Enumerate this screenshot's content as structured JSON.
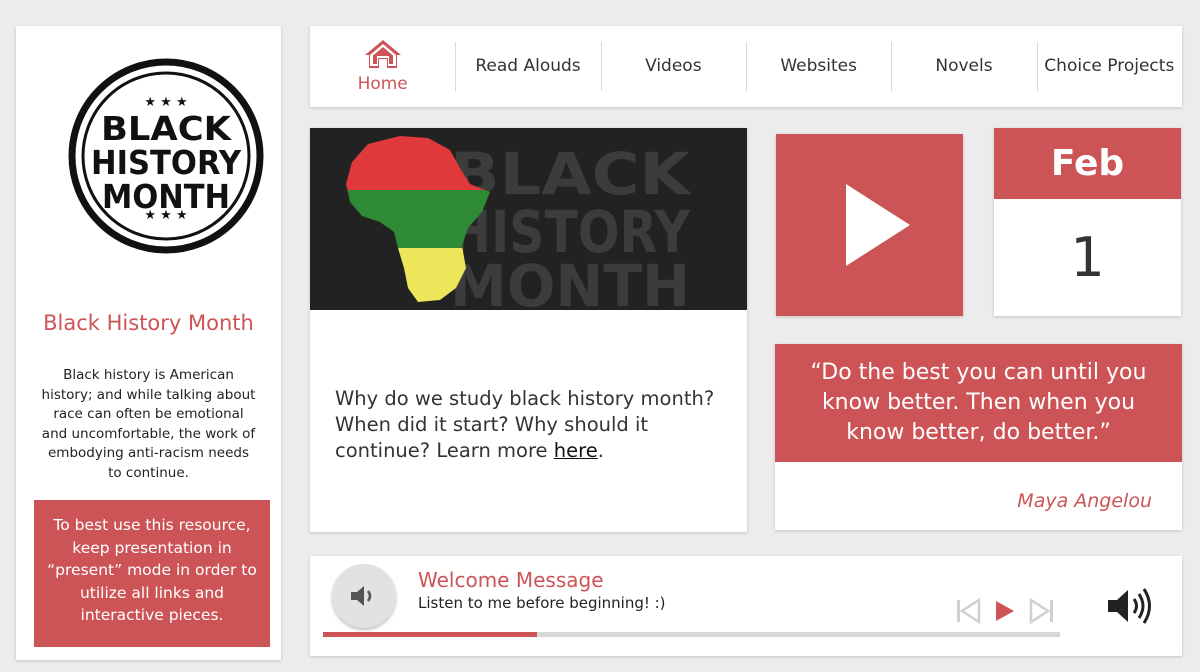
{
  "colors": {
    "accent": "#cd5456",
    "background": "#ececec",
    "card": "#ffffff"
  },
  "sidebar": {
    "logo_text": [
      "BLACK",
      "HISTORY",
      "MONTH"
    ],
    "title": "Black History Month",
    "description": "Black history is American history; and while talking about race can often be emotional and uncomfortable, the work of embodying anti-racism needs to continue.",
    "tip": "To best use this resource, keep presentation in “present” mode in order to utilize all links and interactive pieces."
  },
  "nav": {
    "items": [
      {
        "label": "Home",
        "icon": "home-icon",
        "active": true
      },
      {
        "label": "Read Alouds"
      },
      {
        "label": "Videos"
      },
      {
        "label": "Websites"
      },
      {
        "label": "Novels"
      },
      {
        "label": "Choice Projects"
      }
    ]
  },
  "main": {
    "banner_text": [
      "BLACK",
      "HISTORY",
      "MONTH"
    ],
    "text_before": "Why do we study black history month? When did it start? Why should it continue? Learn more ",
    "link_label": "here",
    "text_after": "."
  },
  "play": {
    "icon": "play-icon"
  },
  "date": {
    "month": "Feb",
    "day": "1"
  },
  "quote": {
    "text": "“Do the best you can until you know better. Then when you know better, do better.”",
    "author": "Maya Angelou"
  },
  "audio": {
    "title": "Welcome Message",
    "subtitle": "Listen to me before beginning! :)",
    "progress": 0.29,
    "icons": [
      "speaker-icon",
      "skip-back-icon",
      "play-icon",
      "skip-forward-icon",
      "volume-icon"
    ]
  }
}
